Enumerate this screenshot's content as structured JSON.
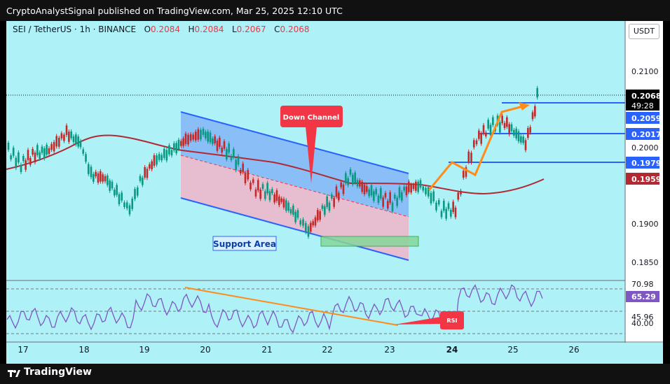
{
  "header": {
    "title": "CryptoAnalystSignal published on TradingView.com, Mar 25, 2025 12:10 UTC"
  },
  "symbol": {
    "name": "SEI / TetherUS · 1h · BINANCE",
    "open_label": "O",
    "open": "0.2084",
    "high_label": "H",
    "high": "0.2084",
    "low_label": "L",
    "low": "0.2067",
    "close_label": "C",
    "close": "0.2068"
  },
  "currency_button": "USDT",
  "price_axis": {
    "ticks": [
      "0.2100",
      "0.2000",
      "0.1900",
      "0.1850"
    ],
    "tags": {
      "last_price": "0.2068",
      "countdown": "49:28",
      "level_1": "0.2059",
      "level_2": "0.2017",
      "level_3": "0.1979",
      "ma_value": "0.1959"
    },
    "colors": {
      "last": "#000000",
      "level": "#2962ff",
      "ma": "#b22833"
    }
  },
  "time_axis": {
    "labels": [
      "17",
      "18",
      "19",
      "20",
      "21",
      "22",
      "23",
      "24",
      "25",
      "26"
    ]
  },
  "annotations": {
    "down_channel": "Down Channel",
    "support_area": "Support Area",
    "rsi": "RSI"
  },
  "rsi_axis": {
    "ticks": [
      "70.98",
      "45.96",
      "40.00"
    ],
    "current": "65.29"
  },
  "footer": {
    "brand": "TradingView"
  }
}
